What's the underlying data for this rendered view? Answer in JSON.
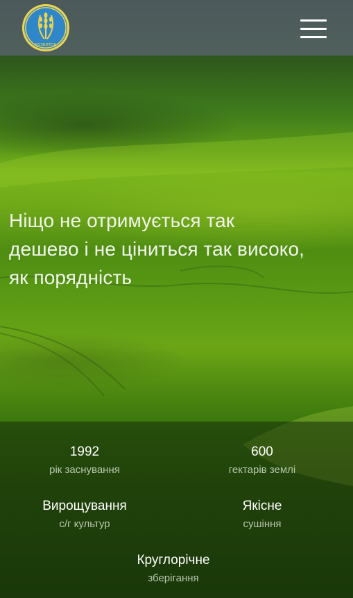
{
  "header": {
    "logo_text": "РОЗВИТОК",
    "menu_icon": "hamburger-menu-icon"
  },
  "hero": {
    "quote_line1": "Ніщо не отримується так",
    "quote_line2": "дешево і не ціниться так високо,",
    "quote_line3": "як порядність"
  },
  "stats": [
    {
      "value": "1992",
      "caption": "рік заснування"
    },
    {
      "value": "600",
      "caption": "гектарів землі"
    },
    {
      "value": "Вирощування",
      "caption": "с/г культур"
    },
    {
      "value": "Якісне",
      "caption": "сушіння"
    },
    {
      "value": "Круглорічне",
      "caption": "зберігання"
    }
  ],
  "colors": {
    "topbar": "#5a646e",
    "logo_blue": "#2f86c9",
    "logo_gold": "#f0d44a",
    "field_green": "#6ea818"
  }
}
